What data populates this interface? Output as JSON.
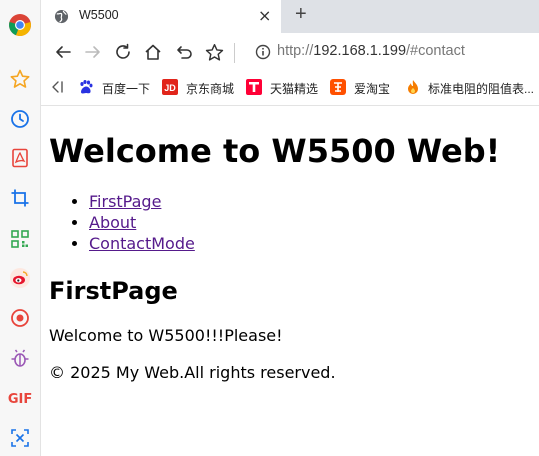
{
  "tab": {
    "title": "W5500",
    "close": "×",
    "new": "+"
  },
  "address": {
    "prefix": "http://",
    "host": "192.168.1.199",
    "path": "/#contact"
  },
  "bookmarks": [
    {
      "label": "百度一下",
      "icon": "baidu-paw-icon"
    },
    {
      "label": "京东商城",
      "icon": "jd-logo-icon"
    },
    {
      "label": "天猫精选",
      "icon": "tmall-logo-icon"
    },
    {
      "label": "爱淘宝",
      "icon": "taobao-logo-icon"
    },
    {
      "label": "标准电阻的阻值表...",
      "icon": "fire-icon"
    }
  ],
  "page": {
    "heading": "Welcome to W5500 Web!",
    "nav": [
      "FirstPage",
      "About",
      "ContactMode"
    ],
    "section_title": "FirstPage",
    "text": "Welcome to W5500!!!Please!",
    "footer": "© 2025 My Web.All rights reserved."
  },
  "sidebar_gif_label": "GIF",
  "colors": {
    "link": "#551a8b",
    "tabstrip": "#dee1e6",
    "accent_red": "#e8453c",
    "accent_blue": "#1a73e8",
    "accent_green": "#34a853"
  }
}
